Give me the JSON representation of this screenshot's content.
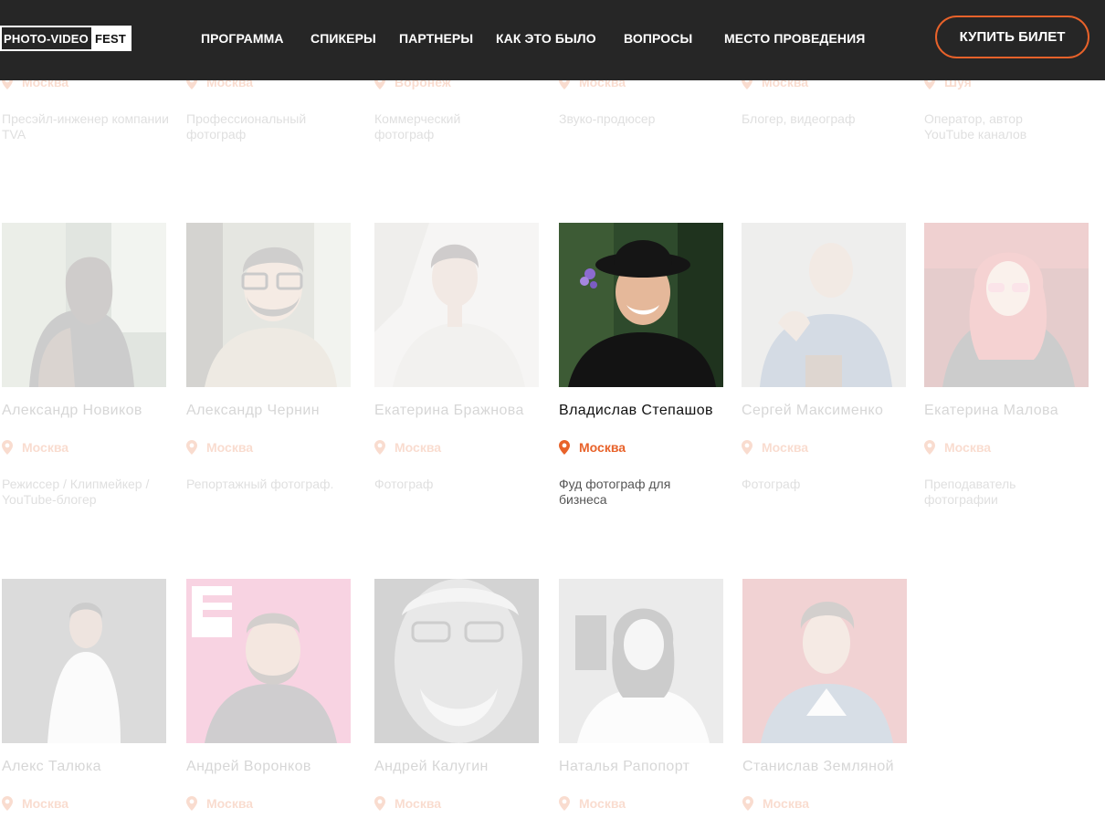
{
  "header": {
    "logo_part1": "PHOTO-VIDEO",
    "logo_part2": "FEST",
    "nav": [
      "ПРОГРАММА",
      "СПИКЕРЫ",
      "ПАРТНЕРЫ",
      "КАК ЭТО БЫЛО",
      "ВОПРОСЫ",
      "МЕСТО ПРОВЕДЕНИЯ"
    ],
    "buy_label": "КУПИТЬ БИЛЕТ"
  },
  "colors": {
    "accent": "#e8622a",
    "header_bg": "#262626"
  },
  "row0": [
    {
      "city": "Москва",
      "role": "Пресэйл-инженер компании TVA"
    },
    {
      "city": "Москва",
      "role": "Профессиональный фотограф"
    },
    {
      "city": "Воронеж",
      "role": "Коммерческий фотограф"
    },
    {
      "city": "Москва",
      "role": "Звуко-продюсер"
    },
    {
      "city": "Москва",
      "role": "Блогер, видеограф"
    },
    {
      "city": "Шуя",
      "role": "Оператор, автор YouTube каналов"
    }
  ],
  "row1": [
    {
      "name": "Александр Новиков",
      "city": "Москва",
      "role": "Режиссер / Клипмейкер / YouTube-блогер"
    },
    {
      "name": "Александр Чернин",
      "city": "Москва",
      "role": "Репортажный фотограф."
    },
    {
      "name": "Екатерина Бражнова",
      "city": "Москва",
      "role": "Фотограф"
    },
    {
      "name": "Владислав Степашов",
      "city": "Москва",
      "role": "Фуд фотограф для бизнеса"
    },
    {
      "name": "Сергей Максименко",
      "city": "Москва",
      "role": "Фотограф"
    },
    {
      "name": "Екатерина Малова",
      "city": "Москва",
      "role": "Преподаватель фотографии"
    }
  ],
  "row2": [
    {
      "name": "Алекс Талюка",
      "city": "Москва"
    },
    {
      "name": "Андрей Воронков",
      "city": "Москва"
    },
    {
      "name": "Андрей Калугин",
      "city": "Москва"
    },
    {
      "name": "Наталья Рапопорт",
      "city": "Москва"
    },
    {
      "name": "Станислав Земляной",
      "city": "Москва"
    }
  ]
}
